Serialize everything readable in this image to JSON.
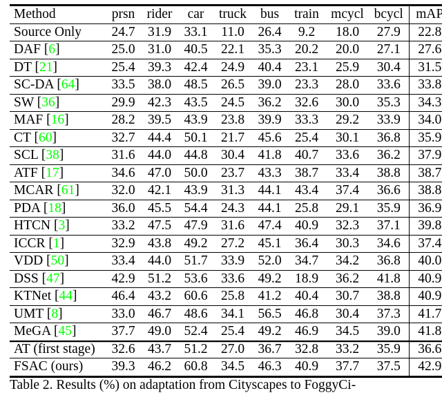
{
  "table": {
    "columns": [
      "Method",
      "prsn",
      "rider",
      "car",
      "truck",
      "bus",
      "train",
      "mcycl",
      "bcycl",
      "mAP"
    ],
    "citation_color": "#00ff00",
    "rows": [
      {
        "method": "Source Only",
        "cite": "",
        "values": [
          "24.7",
          "31.9",
          "33.1",
          "11.0",
          "26.4",
          "9.2",
          "18.0",
          "27.9",
          "22.8"
        ],
        "bold": []
      },
      {
        "method": "DAF",
        "cite": "6",
        "values": [
          "25.0",
          "31.0",
          "40.5",
          "22.1",
          "35.3",
          "20.2",
          "20.0",
          "27.1",
          "27.6"
        ],
        "bold": []
      },
      {
        "method": "DT",
        "cite": "21",
        "values": [
          "25.4",
          "39.3",
          "42.4",
          "24.9",
          "40.4",
          "23.1",
          "25.9",
          "30.4",
          "31.5"
        ],
        "bold": []
      },
      {
        "method": "SC-DA",
        "cite": "64",
        "values": [
          "33.5",
          "38.0",
          "48.5",
          "26.5",
          "39.0",
          "23.3",
          "28.0",
          "33.6",
          "33.8"
        ],
        "bold": []
      },
      {
        "method": "SW",
        "cite": "36",
        "values": [
          "29.9",
          "42.3",
          "43.5",
          "24.5",
          "36.2",
          "32.6",
          "30.0",
          "35.3",
          "34.3"
        ],
        "bold": []
      },
      {
        "method": "MAF",
        "cite": "16",
        "values": [
          "28.2",
          "39.5",
          "43.9",
          "23.8",
          "39.9",
          "33.3",
          "29.2",
          "33.9",
          "34.0"
        ],
        "bold": []
      },
      {
        "method": "CT",
        "cite": "60",
        "values": [
          "32.7",
          "44.4",
          "50.1",
          "21.7",
          "45.6",
          "25.4",
          "30.1",
          "36.8",
          "35.9"
        ],
        "bold": []
      },
      {
        "method": "SCL",
        "cite": "38",
        "values": [
          "31.6",
          "44.0",
          "44.8",
          "30.4",
          "41.8",
          "40.7",
          "33.6",
          "36.2",
          "37.9"
        ],
        "bold": []
      },
      {
        "method": "ATF",
        "cite": "17",
        "values": [
          "34.6",
          "47.0",
          "50.0",
          "23.7",
          "43.3",
          "38.7",
          "33.4",
          "38.8",
          "38.7"
        ],
        "bold": []
      },
      {
        "method": "MCAR",
        "cite": "61",
        "values": [
          "32.0",
          "42.1",
          "43.9",
          "31.3",
          "44.1",
          "43.4",
          "37.4",
          "36.6",
          "38.8"
        ],
        "bold": []
      },
      {
        "method": "PDA",
        "cite": "18",
        "values": [
          "36.0",
          "45.5",
          "54.4",
          "24.3",
          "44.1",
          "25.8",
          "29.1",
          "35.9",
          "36.9"
        ],
        "bold": []
      },
      {
        "method": "HTCN",
        "cite": "3",
        "values": [
          "33.2",
          "47.5",
          "47.9",
          "31.6",
          "47.4",
          "40.9",
          "32.3",
          "37.1",
          "39.8"
        ],
        "bold": []
      },
      {
        "method": "ICCR",
        "cite": "1",
        "values": [
          "32.9",
          "43.8",
          "49.2",
          "27.2",
          "45.1",
          "36.4",
          "30.3",
          "34.6",
          "37.4"
        ],
        "bold": []
      },
      {
        "method": "VDD",
        "cite": "50",
        "values": [
          "33.4",
          "44.0",
          "51.7",
          "33.9",
          "52.0",
          "34.7",
          "34.2",
          "36.8",
          "40.0"
        ],
        "bold": []
      },
      {
        "method": "DSS",
        "cite": "47",
        "values": [
          "42.9",
          "51.2",
          "53.6",
          "33.6",
          "49.2",
          "18.9",
          "36.2",
          "41.8",
          "40.9"
        ],
        "bold": [
          1,
          7
        ]
      },
      {
        "method": "KTNet",
        "cite": "44",
        "values": [
          "46.4",
          "43.2",
          "60.6",
          "25.8",
          "41.2",
          "40.4",
          "30.7",
          "38.8",
          "40.9"
        ],
        "bold": [
          0
        ]
      },
      {
        "method": "UMT",
        "cite": "8",
        "values": [
          "33.0",
          "46.7",
          "48.6",
          "34.1",
          "56.5",
          "46.8",
          "30.4",
          "37.3",
          "41.7"
        ],
        "bold": [
          4
        ]
      },
      {
        "method": "MeGA",
        "cite": "45",
        "values": [
          "37.7",
          "49.0",
          "52.4",
          "25.4",
          "49.2",
          "46.9",
          "34.5",
          "39.0",
          "41.8"
        ],
        "bold": [
          5
        ]
      },
      {
        "method": "AT (first stage)",
        "cite": "",
        "values": [
          "32.6",
          "43.7",
          "51.2",
          "27.0",
          "36.7",
          "32.8",
          "33.2",
          "35.9",
          "36.6"
        ],
        "bold": [],
        "section_start": true
      },
      {
        "method": "FSAC (ours)",
        "cite": "",
        "values": [
          "39.3",
          "46.2",
          "60.8",
          "34.5",
          "46.3",
          "40.9",
          "37.7",
          "37.5",
          "42.9"
        ],
        "bold": [
          2,
          3,
          6,
          8
        ]
      }
    ]
  },
  "caption": {
    "text": "Table 2. Results (%) on adaptation from Cityscapes to FoggyCi-"
  }
}
